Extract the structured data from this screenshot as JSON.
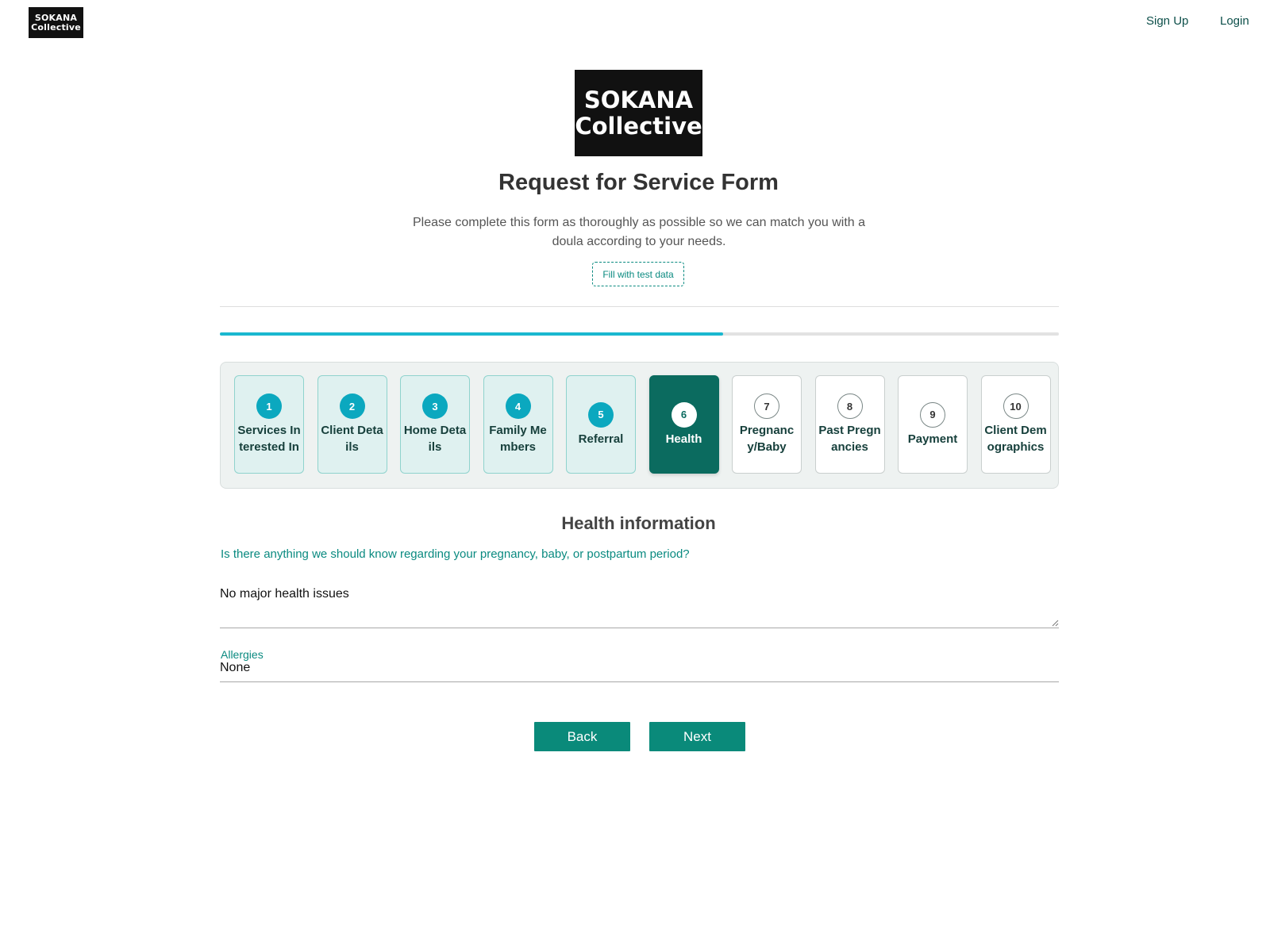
{
  "header": {
    "logo_line1": "SOKANA",
    "logo_line2": "Collective",
    "nav": {
      "signup_label": "Sign Up",
      "login_label": "Login"
    }
  },
  "hero": {
    "logo_line1": "SOKANA",
    "logo_line2": "Collective",
    "title": "Request for Service Form",
    "subtitle": "Please complete this form as thoroughly as possible so we can match you with a doula according to your needs.",
    "test_button_label": "Fill with test data"
  },
  "progress": {
    "fraction": 0.6
  },
  "steps": [
    {
      "number": "1",
      "label": "Services Interested In",
      "state": "done"
    },
    {
      "number": "2",
      "label": "Client Details",
      "state": "done"
    },
    {
      "number": "3",
      "label": "Home Details",
      "state": "done"
    },
    {
      "number": "4",
      "label": "Family Members",
      "state": "done"
    },
    {
      "number": "5",
      "label": "Referral",
      "state": "done"
    },
    {
      "number": "6",
      "label": "Health",
      "state": "active"
    },
    {
      "number": "7",
      "label": "Pregnancy/Baby",
      "state": "pending"
    },
    {
      "number": "8",
      "label": "Past Pregnancies",
      "state": "pending"
    },
    {
      "number": "9",
      "label": "Payment",
      "state": "pending"
    },
    {
      "number": "10",
      "label": "Client Demographics",
      "state": "pending"
    }
  ],
  "health": {
    "section_title": "Health information",
    "question_label": "Is there anything we should know regarding your pregnancy, baby, or postpartum period?",
    "question_value": "No major health issues",
    "allergies_label": "Allergies",
    "allergies_value": "None"
  },
  "actions": {
    "back_label": "Back",
    "next_label": "Next"
  },
  "colors": {
    "accent": "#0a8a7a",
    "active_step": "#0b6b5f",
    "progress": "#1ab8cf"
  }
}
